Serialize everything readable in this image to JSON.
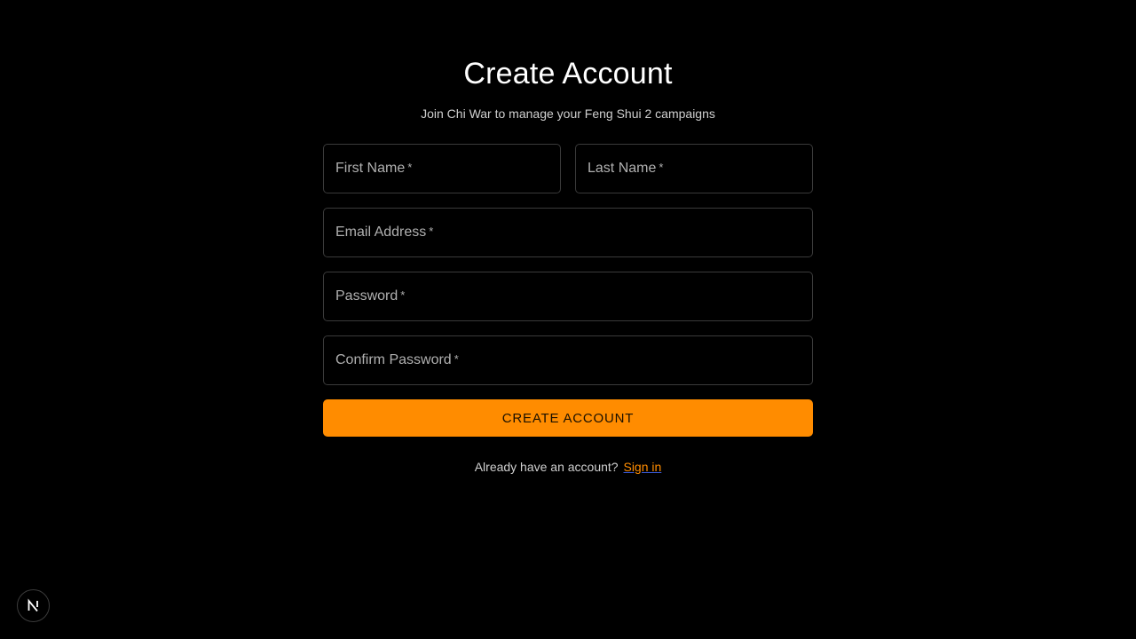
{
  "header": {
    "title": "Create Account",
    "subtitle": "Join Chi War to manage your Feng Shui 2 campaigns"
  },
  "form": {
    "first_name": {
      "label": "First Name",
      "required_mark": "*"
    },
    "last_name": {
      "label": "Last Name",
      "required_mark": "*"
    },
    "email": {
      "label": "Email Address",
      "required_mark": "*"
    },
    "password": {
      "label": "Password",
      "required_mark": "*"
    },
    "confirm_password": {
      "label": "Confirm Password",
      "required_mark": "*"
    },
    "submit_label": "CREATE ACCOUNT"
  },
  "footer": {
    "prompt": "Already have an account?",
    "signin_label": "Sign in"
  },
  "badge": {
    "icon": "nextjs-icon"
  },
  "colors": {
    "background": "#000000",
    "accent": "#ff8c00",
    "field_border": "#3a3a3a",
    "label": "#b0b0b0"
  }
}
